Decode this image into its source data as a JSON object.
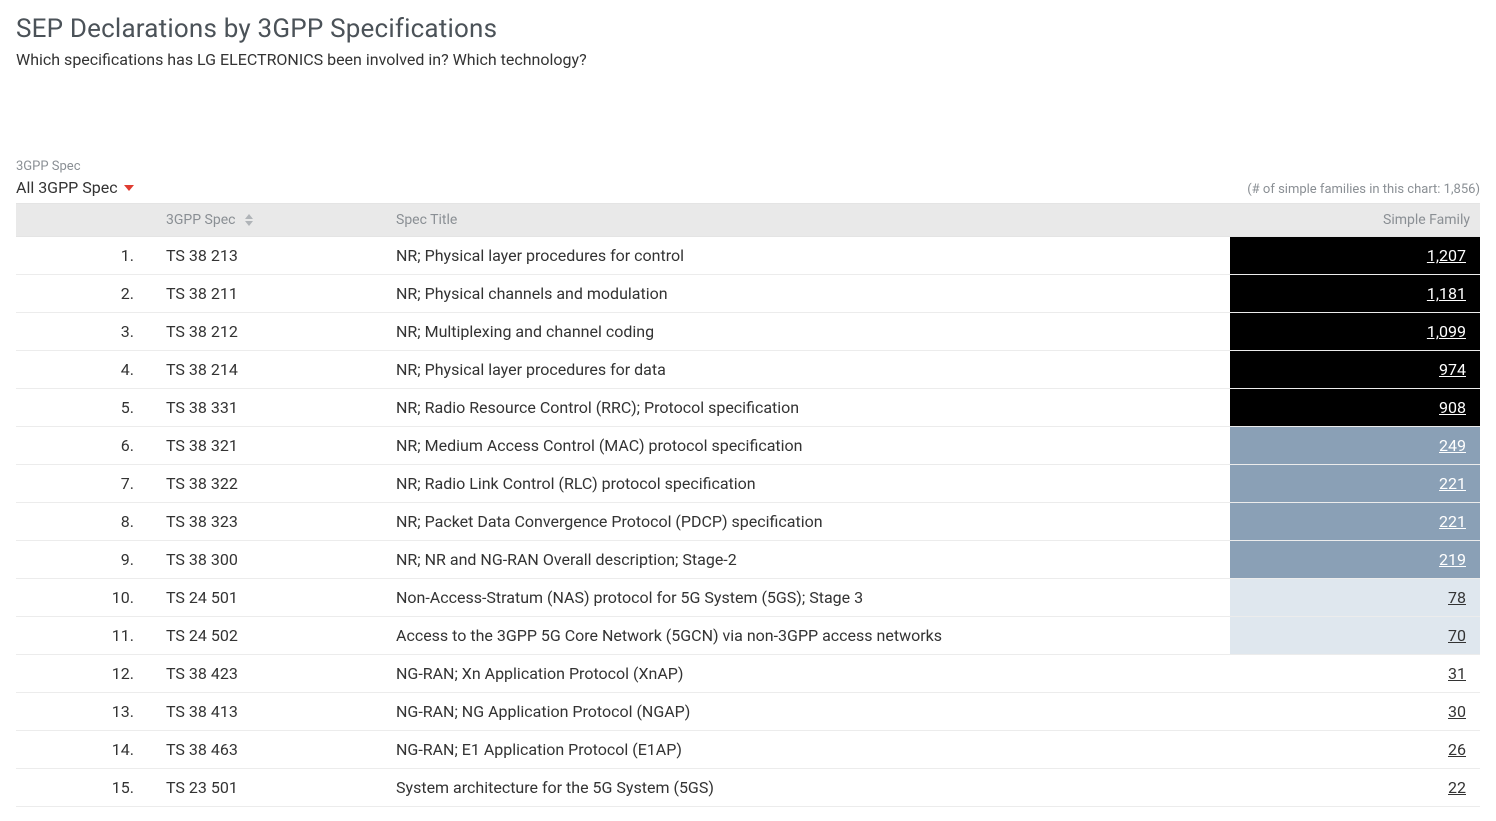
{
  "header": {
    "title": "SEP Declarations by 3GPP Specifications",
    "subtitle": "Which specifications has LG ELECTRONICS been involved in? Which technology?"
  },
  "filter": {
    "label": "3GPP Spec",
    "selected": "All 3GPP Spec"
  },
  "summary": {
    "count_note": "(# of simple families in this chart: 1,856)"
  },
  "columns": {
    "spec": "3GPP Spec",
    "title": "Spec Title",
    "family": "Simple Family"
  },
  "rows": [
    {
      "rank": "1.",
      "spec": "TS 38 213",
      "title": "NR; Physical layer procedures for control",
      "family": "1,207",
      "intensity": 5
    },
    {
      "rank": "2.",
      "spec": "TS 38 211",
      "title": "NR; Physical channels and modulation",
      "family": "1,181",
      "intensity": 5
    },
    {
      "rank": "3.",
      "spec": "TS 38 212",
      "title": "NR; Multiplexing and channel coding",
      "family": "1,099",
      "intensity": 5
    },
    {
      "rank": "4.",
      "spec": "TS 38 214",
      "title": "NR; Physical layer procedures for data",
      "family": "974",
      "intensity": 5
    },
    {
      "rank": "5.",
      "spec": "TS 38 331",
      "title": "NR; Radio Resource Control (RRC); Protocol specification",
      "family": "908",
      "intensity": 5
    },
    {
      "rank": "6.",
      "spec": "TS 38 321",
      "title": "NR; Medium Access Control (MAC) protocol specification",
      "family": "249",
      "intensity": 4
    },
    {
      "rank": "7.",
      "spec": "TS 38 322",
      "title": "NR; Radio Link Control (RLC) protocol specification",
      "family": "221",
      "intensity": 4
    },
    {
      "rank": "8.",
      "spec": "TS 38 323",
      "title": "NR; Packet Data Convergence Protocol (PDCP) specification",
      "family": "221",
      "intensity": 4
    },
    {
      "rank": "9.",
      "spec": "TS 38 300",
      "title": "NR; NR and NG-RAN Overall description; Stage-2",
      "family": "219",
      "intensity": 4
    },
    {
      "rank": "10.",
      "spec": "TS 24 501",
      "title": "Non-Access-Stratum (NAS) protocol for 5G System (5GS); Stage 3",
      "family": "78",
      "intensity": 2
    },
    {
      "rank": "11.",
      "spec": "TS 24 502",
      "title": "Access to the 3GPP 5G Core Network (5GCN) via non-3GPP access networks",
      "family": "70",
      "intensity": 2
    },
    {
      "rank": "12.",
      "spec": "TS 38 423",
      "title": "NG-RAN; Xn Application Protocol (XnAP)",
      "family": "31",
      "intensity": 0
    },
    {
      "rank": "13.",
      "spec": "TS 38 413",
      "title": "NG-RAN; NG Application Protocol (NGAP)",
      "family": "30",
      "intensity": 0
    },
    {
      "rank": "14.",
      "spec": "TS 38 463",
      "title": "NG-RAN; E1 Application Protocol (E1AP)",
      "family": "26",
      "intensity": 0
    },
    {
      "rank": "15.",
      "spec": "TS 23 501",
      "title": "System architecture for the 5G System (5GS)",
      "family": "22",
      "intensity": 0
    }
  ]
}
